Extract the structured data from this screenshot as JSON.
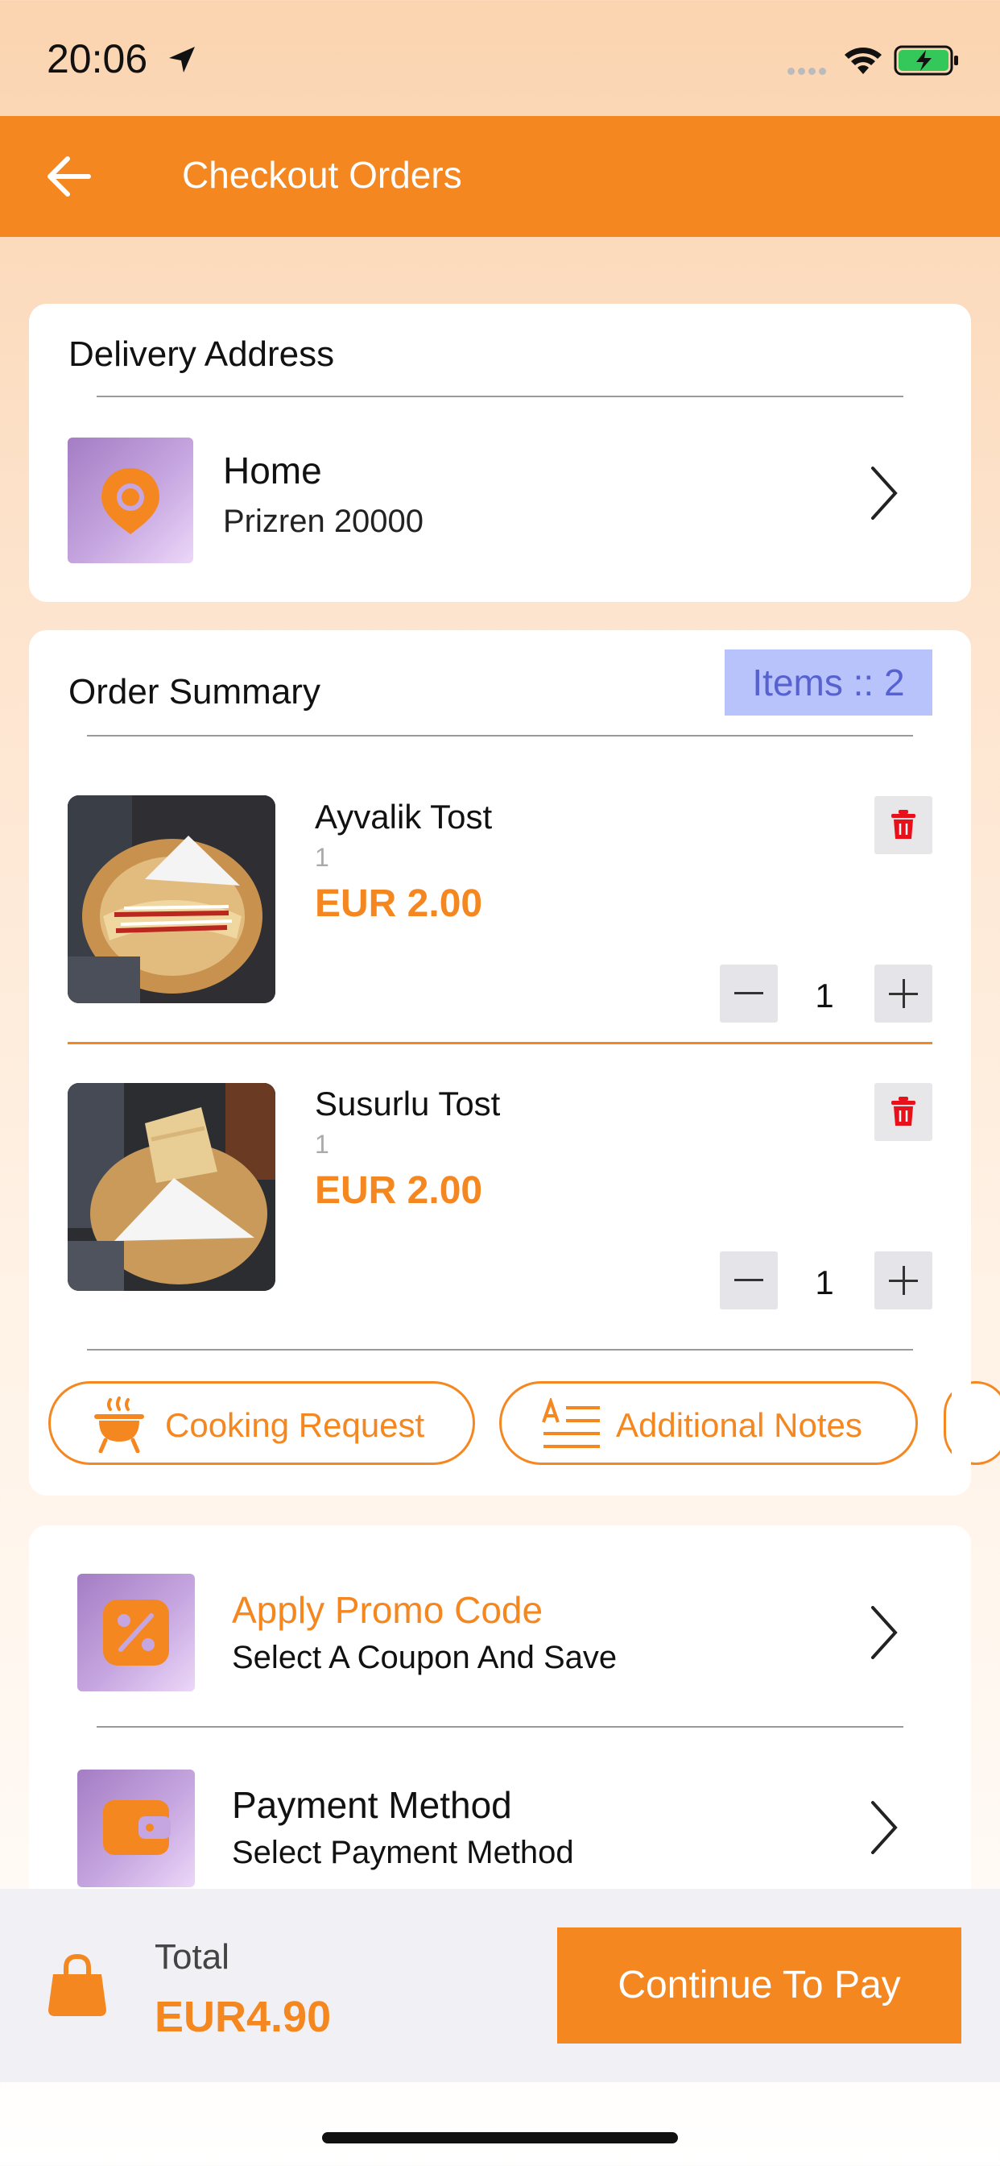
{
  "status": {
    "time": "20:06"
  },
  "header": {
    "title": "Checkout Orders"
  },
  "address": {
    "heading": "Delivery Address",
    "name": "Home",
    "detail": "Prizren 20000"
  },
  "summary": {
    "heading": "Order Summary",
    "items_badge": "Items :: 2",
    "items": [
      {
        "name": "Ayvalik Tost",
        "qty_text": "1",
        "price": "EUR 2.00",
        "quantity": "1"
      },
      {
        "name": "Susurlu Tost",
        "qty_text": "1",
        "price": "EUR 2.00",
        "quantity": "1"
      }
    ],
    "chips": [
      {
        "label": "Cooking Request"
      },
      {
        "label": "Additional Notes"
      }
    ]
  },
  "options": {
    "promo": {
      "title": "Apply Promo Code",
      "subtitle": "Select A Coupon And Save"
    },
    "payment": {
      "title": "Payment Method",
      "subtitle": "Select Payment Method"
    }
  },
  "footer": {
    "total_label": "Total",
    "total_value": "EUR4.90",
    "pay_label": "Continue To Pay"
  },
  "colors": {
    "accent": "#f58720",
    "badge_bg": "#b9c3fb",
    "badge_text": "#5761cf",
    "delete": "#e8111b"
  }
}
